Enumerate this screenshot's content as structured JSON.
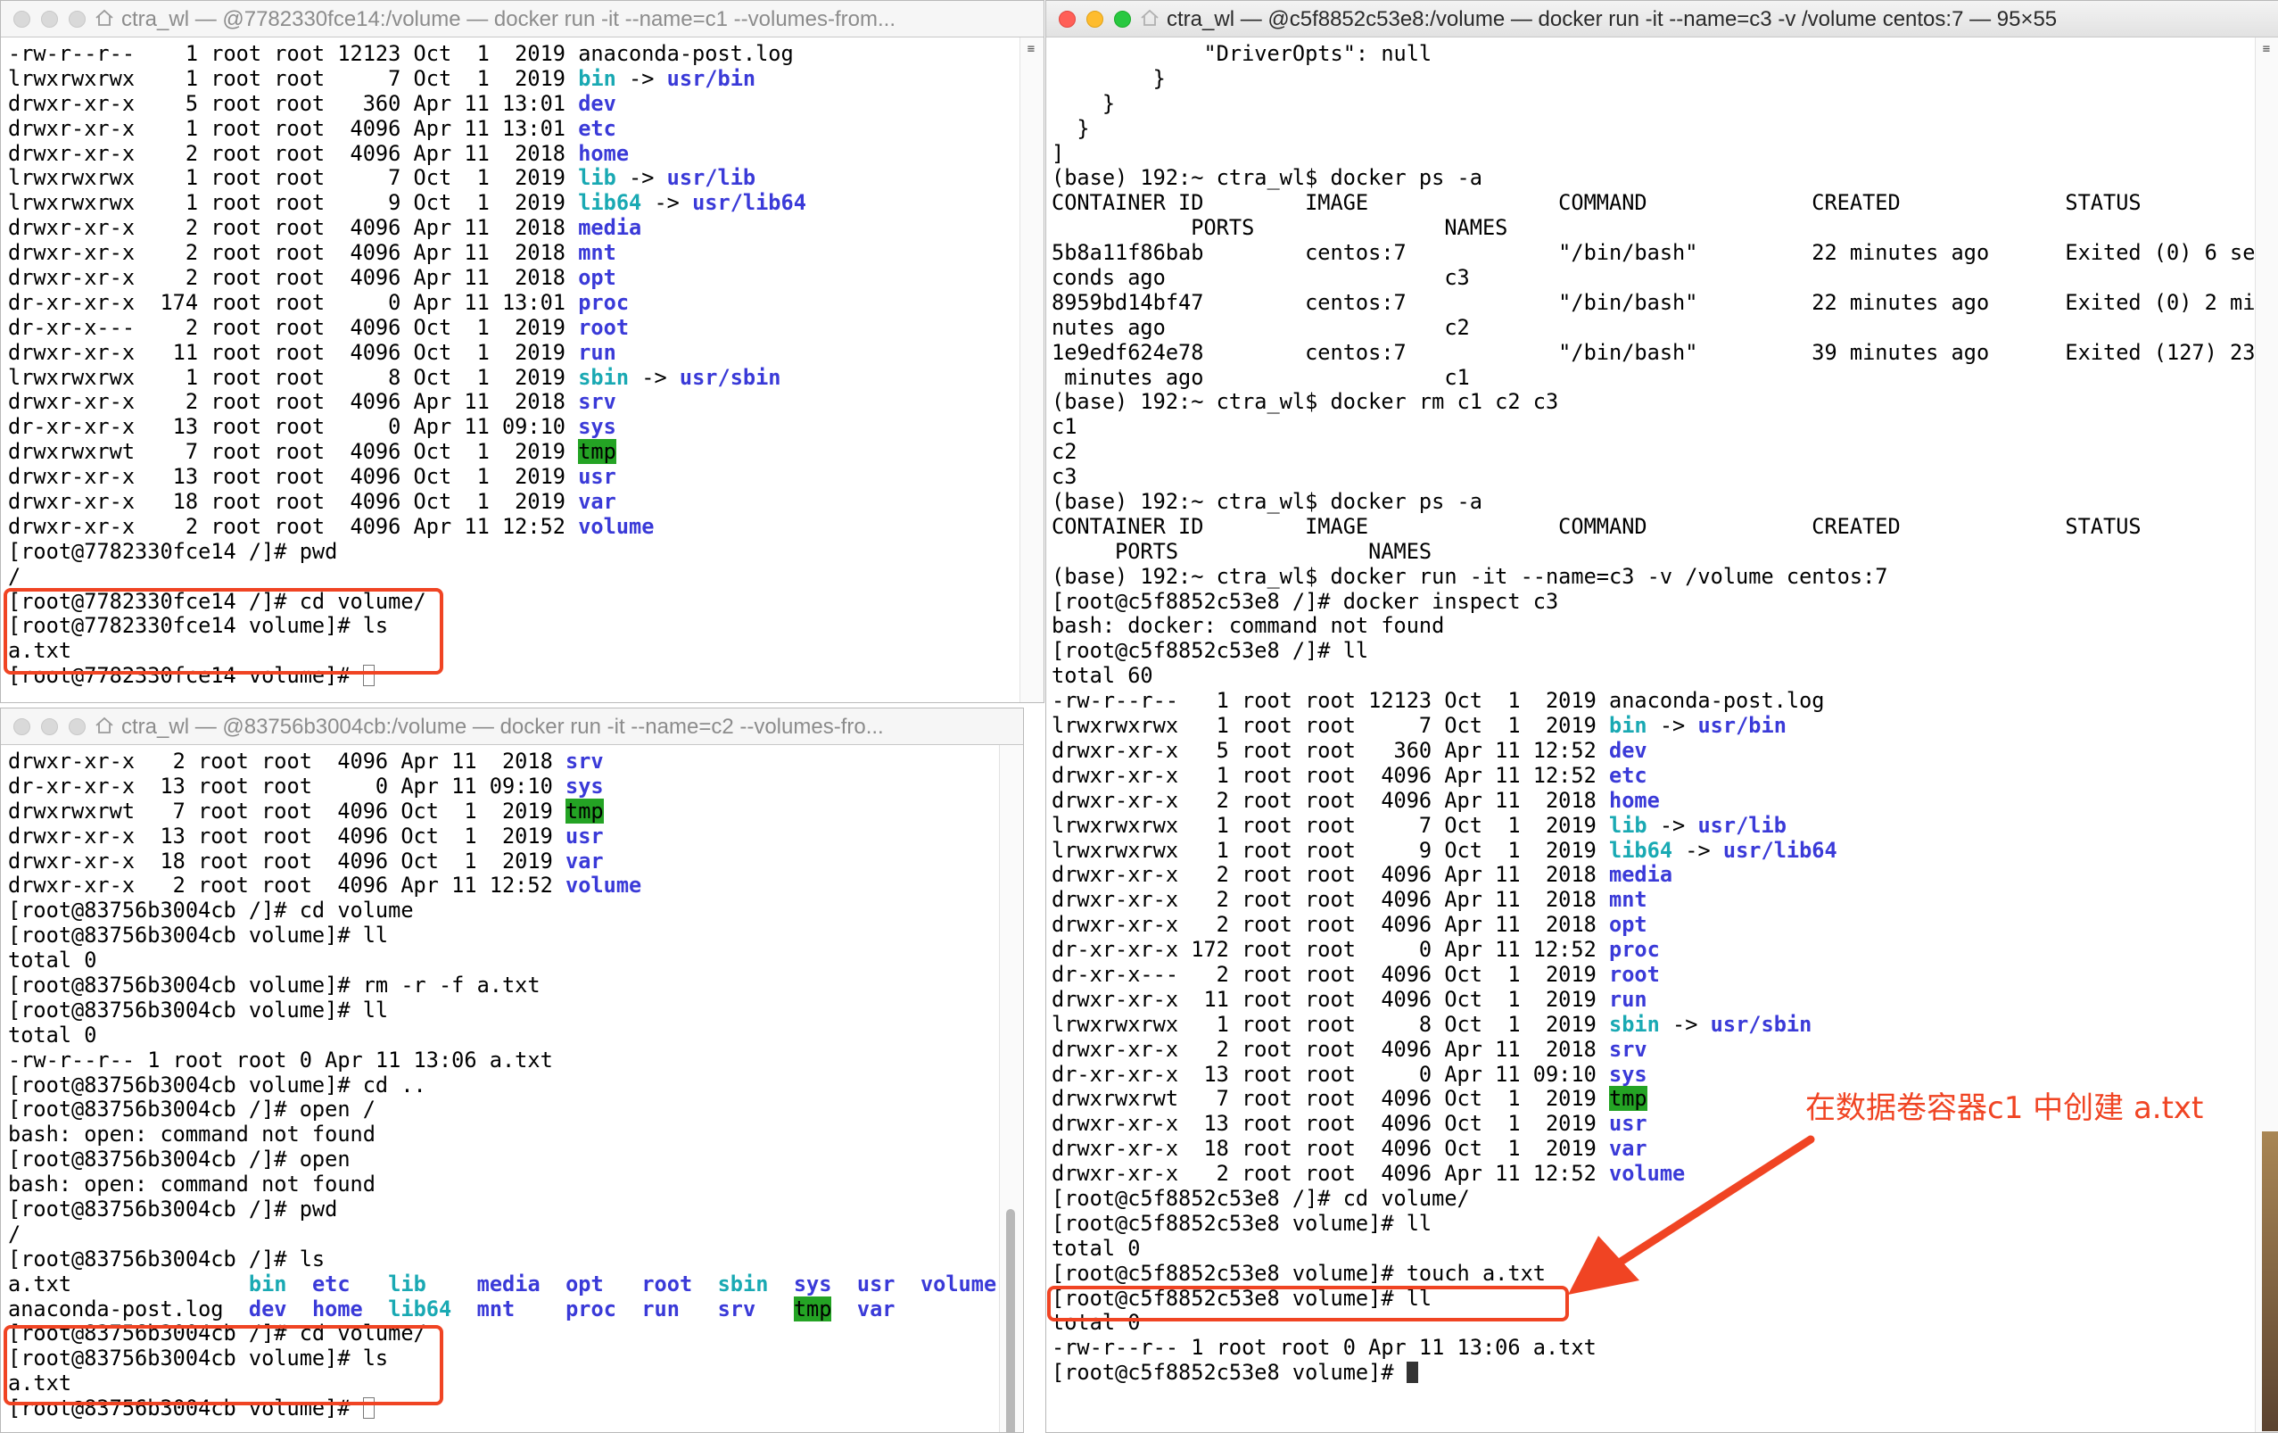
{
  "windows": {
    "c1": {
      "title": "ctra_wl — @7782330fce14:/volume — docker run -it --name=c1 --volumes-from...",
      "lines": [
        [
          {
            "t": "-rw-r--r--    1 root root 12123 Oct  1  2019 anaconda-post.log"
          }
        ],
        [
          {
            "t": "lrwxrwxrwx    1 root root     7 Oct  1  2019 "
          },
          {
            "t": "bin",
            "c": "cyan"
          },
          {
            "t": " -> "
          },
          {
            "t": "usr/bin",
            "c": "blue"
          }
        ],
        [
          {
            "t": "drwxr-xr-x    5 root root   360 Apr 11 13:01 "
          },
          {
            "t": "dev",
            "c": "blue"
          }
        ],
        [
          {
            "t": "drwxr-xr-x    1 root root  4096 Apr 11 13:01 "
          },
          {
            "t": "etc",
            "c": "blue"
          }
        ],
        [
          {
            "t": "drwxr-xr-x    2 root root  4096 Apr 11  2018 "
          },
          {
            "t": "home",
            "c": "blue"
          }
        ],
        [
          {
            "t": "lrwxrwxrwx    1 root root     7 Oct  1  2019 "
          },
          {
            "t": "lib",
            "c": "cyan"
          },
          {
            "t": " -> "
          },
          {
            "t": "usr/lib",
            "c": "blue"
          }
        ],
        [
          {
            "t": "lrwxrwxrwx    1 root root     9 Oct  1  2019 "
          },
          {
            "t": "lib64",
            "c": "cyan"
          },
          {
            "t": " -> "
          },
          {
            "t": "usr/lib64",
            "c": "blue"
          }
        ],
        [
          {
            "t": "drwxr-xr-x    2 root root  4096 Apr 11  2018 "
          },
          {
            "t": "media",
            "c": "blue"
          }
        ],
        [
          {
            "t": "drwxr-xr-x    2 root root  4096 Apr 11  2018 "
          },
          {
            "t": "mnt",
            "c": "blue"
          }
        ],
        [
          {
            "t": "drwxr-xr-x    2 root root  4096 Apr 11  2018 "
          },
          {
            "t": "opt",
            "c": "blue"
          }
        ],
        [
          {
            "t": "dr-xr-xr-x  174 root root     0 Apr 11 13:01 "
          },
          {
            "t": "proc",
            "c": "blue"
          }
        ],
        [
          {
            "t": "dr-xr-x---    2 root root  4096 Oct  1  2019 "
          },
          {
            "t": "root",
            "c": "blue"
          }
        ],
        [
          {
            "t": "drwxr-xr-x   11 root root  4096 Oct  1  2019 "
          },
          {
            "t": "run",
            "c": "blue"
          }
        ],
        [
          {
            "t": "lrwxrwxrwx    1 root root     8 Oct  1  2019 "
          },
          {
            "t": "sbin",
            "c": "cyan"
          },
          {
            "t": " -> "
          },
          {
            "t": "usr/sbin",
            "c": "blue"
          }
        ],
        [
          {
            "t": "drwxr-xr-x    2 root root  4096 Apr 11  2018 "
          },
          {
            "t": "srv",
            "c": "blue"
          }
        ],
        [
          {
            "t": "dr-xr-xr-x   13 root root     0 Apr 11 09:10 "
          },
          {
            "t": "sys",
            "c": "blue"
          }
        ],
        [
          {
            "t": "drwxrwxrwt    7 root root  4096 Oct  1  2019 "
          },
          {
            "t": "tmp",
            "c": "green"
          }
        ],
        [
          {
            "t": "drwxr-xr-x   13 root root  4096 Oct  1  2019 "
          },
          {
            "t": "usr",
            "c": "blue"
          }
        ],
        [
          {
            "t": "drwxr-xr-x   18 root root  4096 Oct  1  2019 "
          },
          {
            "t": "var",
            "c": "blue"
          }
        ],
        [
          {
            "t": "drwxr-xr-x    2 root root  4096 Apr 11 12:52 "
          },
          {
            "t": "volume",
            "c": "blue"
          }
        ],
        [
          {
            "t": "[root@7782330fce14 /]# pwd"
          }
        ],
        [
          {
            "t": "/"
          }
        ],
        [
          {
            "t": "[root@7782330fce14 /]# cd volume/"
          }
        ],
        [
          {
            "t": "[root@7782330fce14 volume]# ls"
          }
        ],
        [
          {
            "t": "a.txt"
          }
        ],
        [
          {
            "t": "[root@7782330fce14 volume]# "
          },
          {
            "cursor": "hollow"
          }
        ]
      ]
    },
    "c2": {
      "title": "ctra_wl — @83756b3004cb:/volume — docker run -it --name=c2 --volumes-fro...",
      "lines": [
        [
          {
            "t": "drwxr-xr-x   2 root root  4096 Apr 11  2018 "
          },
          {
            "t": "srv",
            "c": "blue"
          }
        ],
        [
          {
            "t": "dr-xr-xr-x  13 root root     0 Apr 11 09:10 "
          },
          {
            "t": "sys",
            "c": "blue"
          }
        ],
        [
          {
            "t": "drwxrwxrwt   7 root root  4096 Oct  1  2019 "
          },
          {
            "t": "tmp",
            "c": "green"
          }
        ],
        [
          {
            "t": "drwxr-xr-x  13 root root  4096 Oct  1  2019 "
          },
          {
            "t": "usr",
            "c": "blue"
          }
        ],
        [
          {
            "t": "drwxr-xr-x  18 root root  4096 Oct  1  2019 "
          },
          {
            "t": "var",
            "c": "blue"
          }
        ],
        [
          {
            "t": "drwxr-xr-x   2 root root  4096 Apr 11 12:52 "
          },
          {
            "t": "volume",
            "c": "blue"
          }
        ],
        [
          {
            "t": "[root@83756b3004cb /]# cd volume"
          }
        ],
        [
          {
            "t": "[root@83756b3004cb volume]# ll"
          }
        ],
        [
          {
            "t": "total 0"
          }
        ],
        [
          {
            "t": "[root@83756b3004cb volume]# rm -r -f a.txt"
          }
        ],
        [
          {
            "t": "[root@83756b3004cb volume]# ll"
          }
        ],
        [
          {
            "t": "total 0"
          }
        ],
        [
          {
            "t": "-rw-r--r-- 1 root root 0 Apr 11 13:06 a.txt"
          }
        ],
        [
          {
            "t": "[root@83756b3004cb volume]# cd .."
          }
        ],
        [
          {
            "t": "[root@83756b3004cb /]# open /"
          }
        ],
        [
          {
            "t": "bash: open: command not found"
          }
        ],
        [
          {
            "t": "[root@83756b3004cb /]# open"
          }
        ],
        [
          {
            "t": "bash: open: command not found"
          }
        ],
        [
          {
            "t": "[root@83756b3004cb /]# pwd"
          }
        ],
        [
          {
            "t": "/"
          }
        ],
        [
          {
            "t": "[root@83756b3004cb /]# ls"
          }
        ],
        [
          {
            "t": "a.txt              "
          },
          {
            "t": "bin",
            "c": "cyan"
          },
          {
            "t": "  "
          },
          {
            "t": "etc",
            "c": "blue"
          },
          {
            "t": "   "
          },
          {
            "t": "lib",
            "c": "cyan"
          },
          {
            "t": "    "
          },
          {
            "t": "media",
            "c": "blue"
          },
          {
            "t": "  "
          },
          {
            "t": "opt",
            "c": "blue"
          },
          {
            "t": "   "
          },
          {
            "t": "root",
            "c": "blue"
          },
          {
            "t": "  "
          },
          {
            "t": "sbin",
            "c": "cyan"
          },
          {
            "t": "  "
          },
          {
            "t": "sys",
            "c": "blue"
          },
          {
            "t": "  "
          },
          {
            "t": "usr",
            "c": "blue"
          },
          {
            "t": "  "
          },
          {
            "t": "volume",
            "c": "blue"
          }
        ],
        [
          {
            "t": "anaconda-post.log  "
          },
          {
            "t": "dev",
            "c": "blue"
          },
          {
            "t": "  "
          },
          {
            "t": "home",
            "c": "blue"
          },
          {
            "t": "  "
          },
          {
            "t": "lib64",
            "c": "cyan"
          },
          {
            "t": "  "
          },
          {
            "t": "mnt",
            "c": "blue"
          },
          {
            "t": "    "
          },
          {
            "t": "proc",
            "c": "blue"
          },
          {
            "t": "  "
          },
          {
            "t": "run",
            "c": "blue"
          },
          {
            "t": "   "
          },
          {
            "t": "srv",
            "c": "blue"
          },
          {
            "t": "   "
          },
          {
            "t": "tmp",
            "c": "green"
          },
          {
            "t": "  "
          },
          {
            "t": "var",
            "c": "blue"
          }
        ],
        [
          {
            "t": "[root@83756b3004cb /]# cd volume/"
          }
        ],
        [
          {
            "t": "[root@83756b3004cb volume]# ls"
          }
        ],
        [
          {
            "t": "a.txt"
          }
        ],
        [
          {
            "t": "[root@83756b3004cb volume]# "
          },
          {
            "cursor": "hollow"
          }
        ]
      ]
    },
    "c3": {
      "title": "ctra_wl — @c5f8852c53e8:/volume — docker run -it --name=c3 -v /volume centos:7 — 95×55",
      "lines": [
        [
          {
            "t": "            \"DriverOpts\": null"
          }
        ],
        [
          {
            "t": "        }"
          }
        ],
        [
          {
            "t": "    }"
          }
        ],
        [
          {
            "t": "  }"
          }
        ],
        [
          {
            "t": "]"
          }
        ],
        [
          {
            "t": "(base) 192:~ ctra_wl$ docker ps -a"
          }
        ],
        [
          {
            "t": "CONTAINER ID        IMAGE               COMMAND             CREATED             STATUS"
          }
        ],
        [
          {
            "t": "           PORTS               NAMES"
          }
        ],
        [
          {
            "t": "5b8a11f86bab        centos:7            \"/bin/bash\"         22 minutes ago      Exited (0) 6 se"
          }
        ],
        [
          {
            "t": "conds ago                      c3"
          }
        ],
        [
          {
            "t": "8959bd14bf47        centos:7            \"/bin/bash\"         22 minutes ago      Exited (0) 2 mi"
          }
        ],
        [
          {
            "t": "nutes ago                      c2"
          }
        ],
        [
          {
            "t": "1e9edf624e78        centos:7            \"/bin/bash\"         39 minutes ago      Exited (127) 23"
          }
        ],
        [
          {
            "t": " minutes ago                   c1"
          }
        ],
        [
          {
            "t": "(base) 192:~ ctra_wl$ docker rm c1 c2 c3"
          }
        ],
        [
          {
            "t": "c1"
          }
        ],
        [
          {
            "t": "c2"
          }
        ],
        [
          {
            "t": "c3"
          }
        ],
        [
          {
            "t": "(base) 192:~ ctra_wl$ docker ps -a"
          }
        ],
        [
          {
            "t": "CONTAINER ID        IMAGE               COMMAND             CREATED             STATUS"
          }
        ],
        [
          {
            "t": "     PORTS               NAMES"
          }
        ],
        [
          {
            "t": "(base) 192:~ ctra_wl$ docker run -it --name=c3 -v /volume centos:7"
          }
        ],
        [
          {
            "t": "[root@c5f8852c53e8 /]# docker inspect c3"
          }
        ],
        [
          {
            "t": "bash: docker: command not found"
          }
        ],
        [
          {
            "t": "[root@c5f8852c53e8 /]# ll"
          }
        ],
        [
          {
            "t": "total 60"
          }
        ],
        [
          {
            "t": "-rw-r--r--   1 root root 12123 Oct  1  2019 anaconda-post.log"
          }
        ],
        [
          {
            "t": "lrwxrwxrwx   1 root root     7 Oct  1  2019 "
          },
          {
            "t": "bin",
            "c": "cyan"
          },
          {
            "t": " -> "
          },
          {
            "t": "usr/bin",
            "c": "blue"
          }
        ],
        [
          {
            "t": "drwxr-xr-x   5 root root   360 Apr 11 12:52 "
          },
          {
            "t": "dev",
            "c": "blue"
          }
        ],
        [
          {
            "t": "drwxr-xr-x   1 root root  4096 Apr 11 12:52 "
          },
          {
            "t": "etc",
            "c": "blue"
          }
        ],
        [
          {
            "t": "drwxr-xr-x   2 root root  4096 Apr 11  2018 "
          },
          {
            "t": "home",
            "c": "blue"
          }
        ],
        [
          {
            "t": "lrwxrwxrwx   1 root root     7 Oct  1  2019 "
          },
          {
            "t": "lib",
            "c": "cyan"
          },
          {
            "t": " -> "
          },
          {
            "t": "usr/lib",
            "c": "blue"
          }
        ],
        [
          {
            "t": "lrwxrwxrwx   1 root root     9 Oct  1  2019 "
          },
          {
            "t": "lib64",
            "c": "cyan"
          },
          {
            "t": " -> "
          },
          {
            "t": "usr/lib64",
            "c": "blue"
          }
        ],
        [
          {
            "t": "drwxr-xr-x   2 root root  4096 Apr 11  2018 "
          },
          {
            "t": "media",
            "c": "blue"
          }
        ],
        [
          {
            "t": "drwxr-xr-x   2 root root  4096 Apr 11  2018 "
          },
          {
            "t": "mnt",
            "c": "blue"
          }
        ],
        [
          {
            "t": "drwxr-xr-x   2 root root  4096 Apr 11  2018 "
          },
          {
            "t": "opt",
            "c": "blue"
          }
        ],
        [
          {
            "t": "dr-xr-xr-x 172 root root     0 Apr 11 12:52 "
          },
          {
            "t": "proc",
            "c": "blue"
          }
        ],
        [
          {
            "t": "dr-xr-x---   2 root root  4096 Oct  1  2019 "
          },
          {
            "t": "root",
            "c": "blue"
          }
        ],
        [
          {
            "t": "drwxr-xr-x  11 root root  4096 Oct  1  2019 "
          },
          {
            "t": "run",
            "c": "blue"
          }
        ],
        [
          {
            "t": "lrwxrwxrwx   1 root root     8 Oct  1  2019 "
          },
          {
            "t": "sbin",
            "c": "cyan"
          },
          {
            "t": " -> "
          },
          {
            "t": "usr/sbin",
            "c": "blue"
          }
        ],
        [
          {
            "t": "drwxr-xr-x   2 root root  4096 Apr 11  2018 "
          },
          {
            "t": "srv",
            "c": "blue"
          }
        ],
        [
          {
            "t": "dr-xr-xr-x  13 root root     0 Apr 11 09:10 "
          },
          {
            "t": "sys",
            "c": "blue"
          }
        ],
        [
          {
            "t": "drwxrwxrwt   7 root root  4096 Oct  1  2019 "
          },
          {
            "t": "tmp",
            "c": "green"
          }
        ],
        [
          {
            "t": "drwxr-xr-x  13 root root  4096 Oct  1  2019 "
          },
          {
            "t": "usr",
            "c": "blue"
          }
        ],
        [
          {
            "t": "drwxr-xr-x  18 root root  4096 Oct  1  2019 "
          },
          {
            "t": "var",
            "c": "blue"
          }
        ],
        [
          {
            "t": "drwxr-xr-x   2 root root  4096 Apr 11 12:52 "
          },
          {
            "t": "volume",
            "c": "blue"
          }
        ],
        [
          {
            "t": "[root@c5f8852c53e8 /]# cd volume/"
          }
        ],
        [
          {
            "t": "[root@c5f8852c53e8 volume]# ll"
          }
        ],
        [
          {
            "t": "total 0"
          }
        ],
        [
          {
            "t": "[root@c5f8852c53e8 volume]# touch a.txt"
          }
        ],
        [
          {
            "t": "[root@c5f8852c53e8 volume]# ll"
          }
        ],
        [
          {
            "t": "total 0"
          }
        ],
        [
          {
            "t": "-rw-r--r-- 1 root root 0 Apr 11 13:06 a.txt"
          }
        ],
        [
          {
            "t": "[root@c5f8852c53e8 volume]# "
          },
          {
            "cursor": "solid"
          }
        ]
      ]
    }
  },
  "annotation": {
    "text": "在数据卷容器c1 中创建 a.txt",
    "color": "#f04423"
  },
  "colors": {
    "symlink": "#19a9b3",
    "directory": "#3a3ad8",
    "sticky_dir_bg": "#24a324",
    "highlight": "#f04423"
  }
}
